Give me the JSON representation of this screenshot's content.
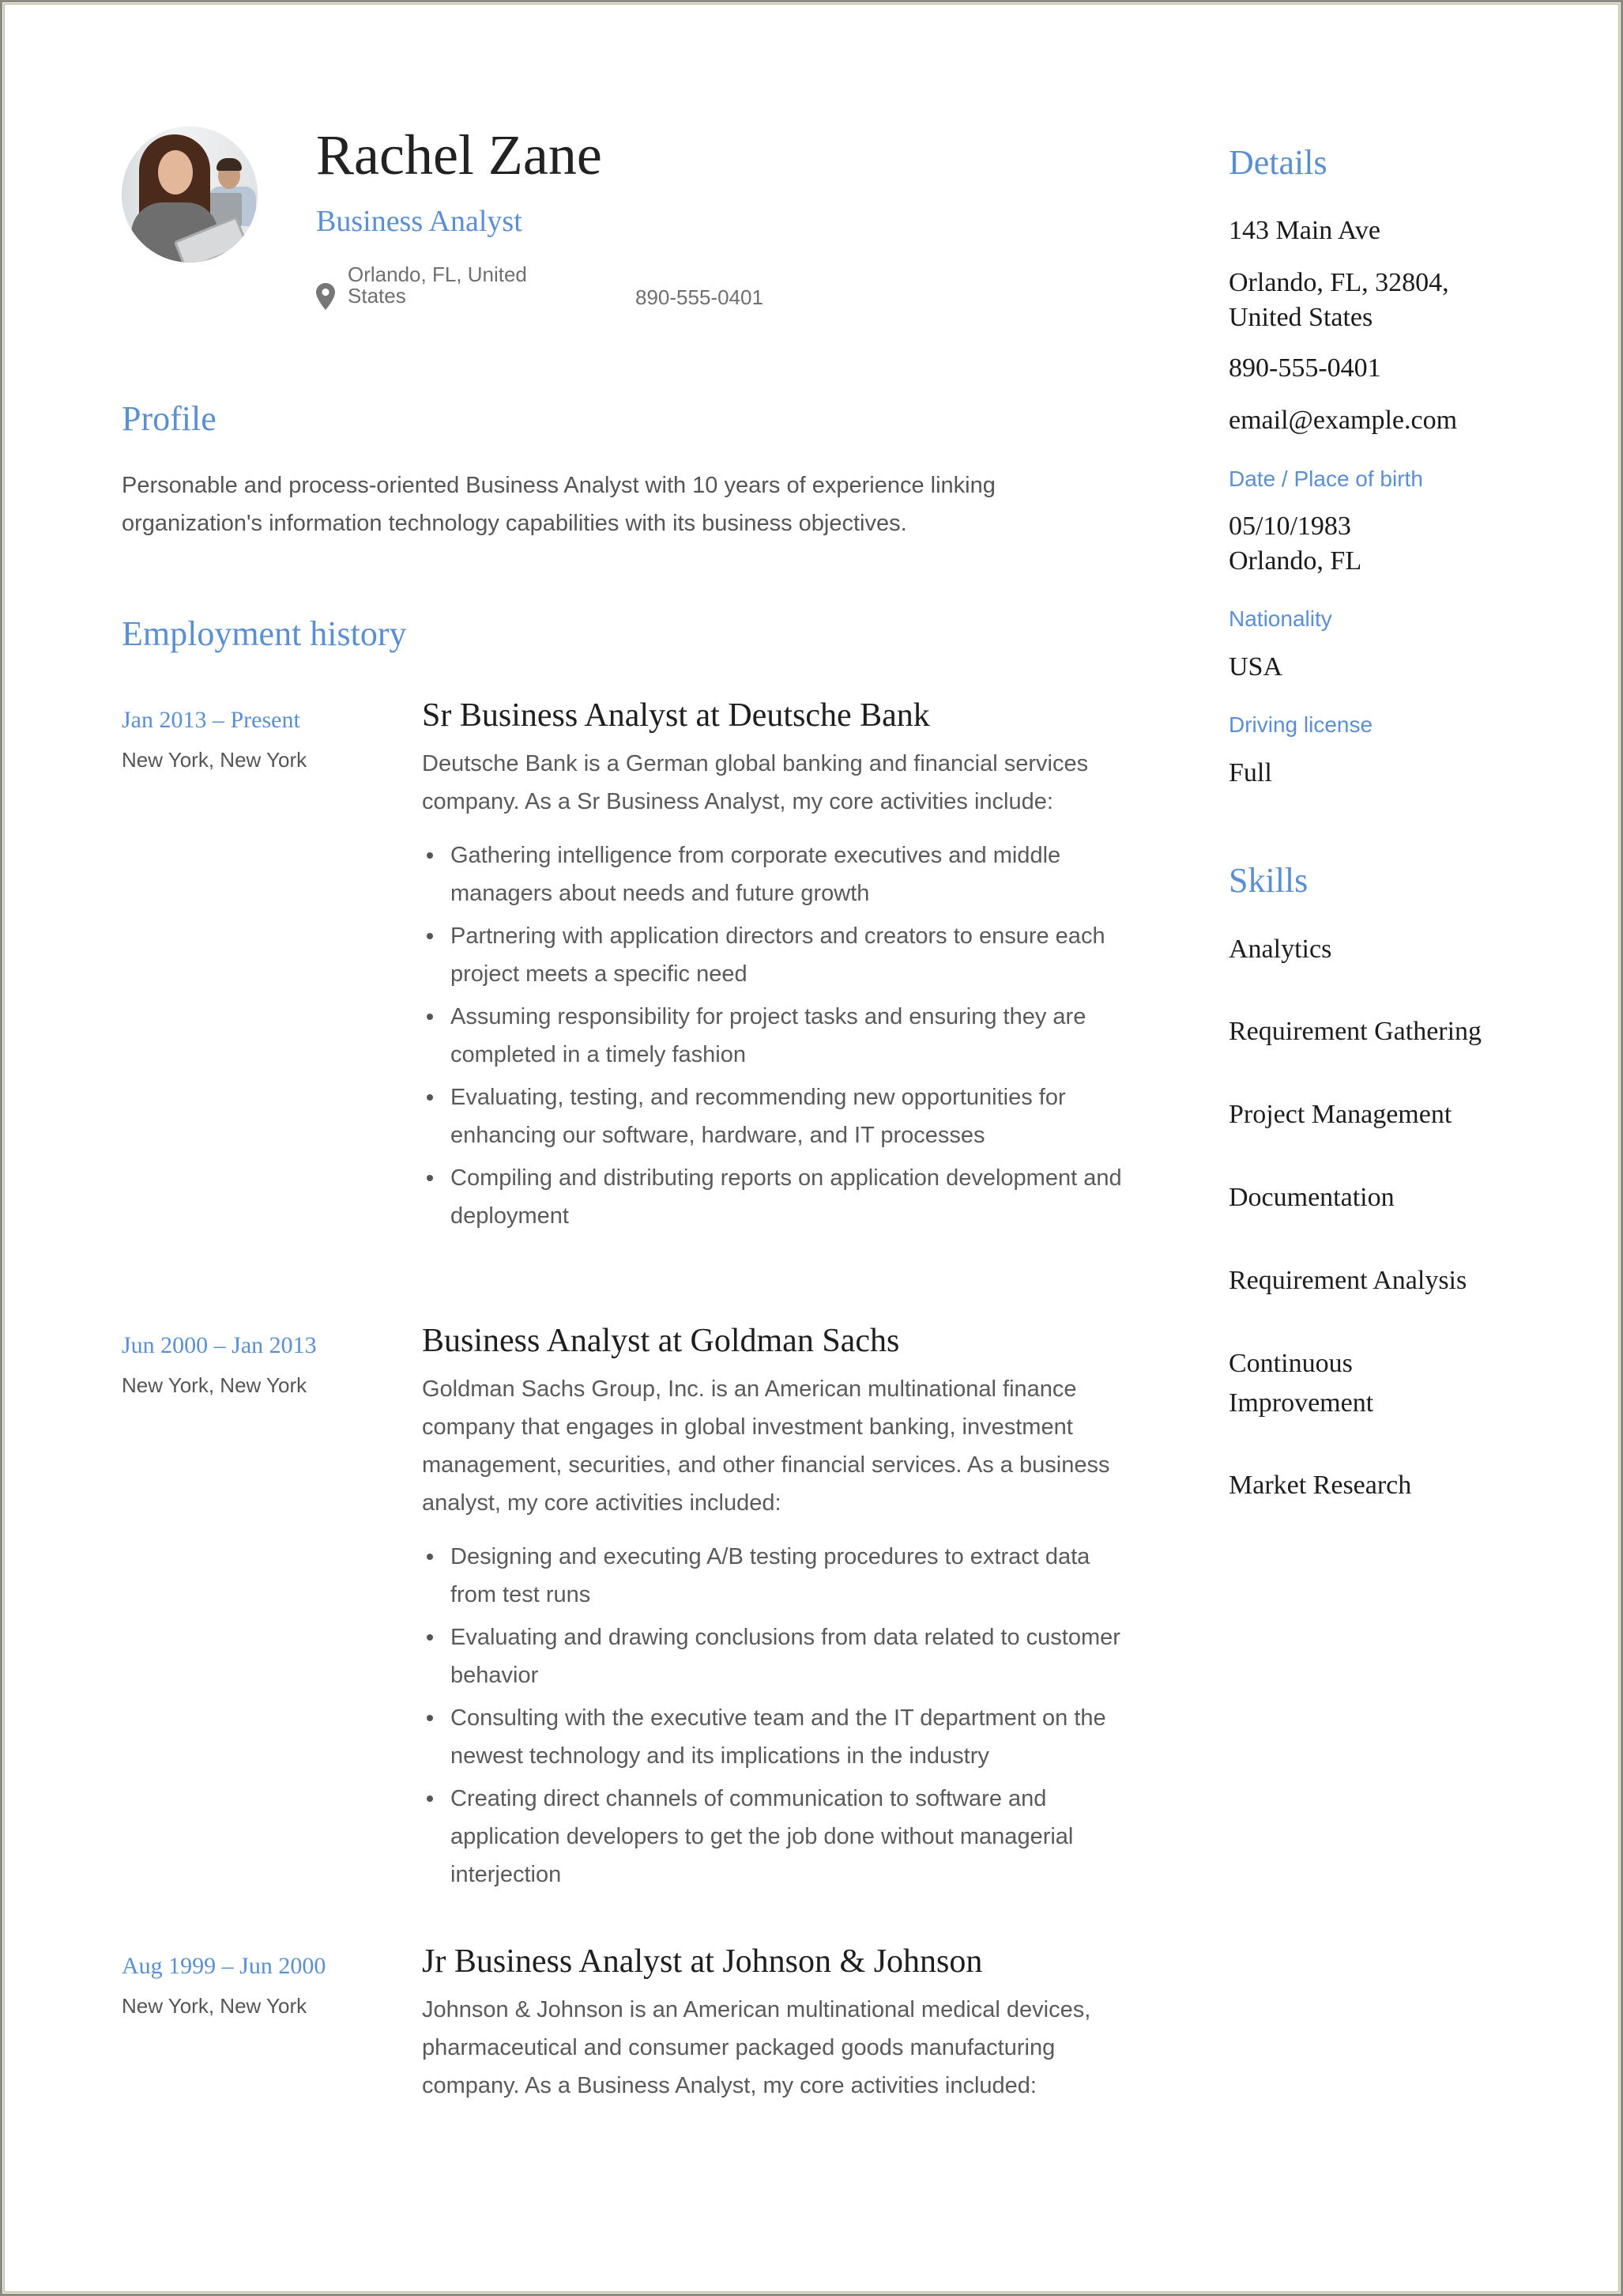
{
  "header": {
    "name": "Rachel Zane",
    "title": "Business Analyst",
    "location": "Orlando, FL, United States",
    "phone": "890-555-0401",
    "avatar_icon": "profile-photo"
  },
  "profile": {
    "heading": "Profile",
    "text": "Personable and process-oriented Business Analyst with 10 years of experience linking organization's information technology capabilities with its business objectives."
  },
  "employment": {
    "heading": "Employment history",
    "jobs": [
      {
        "dates": "Jan 2013 – Present",
        "place": "New York, New York",
        "role": "Sr Business Analyst at Deutsche Bank",
        "description": "Deutsche Bank is a German global banking and financial services company. As a Sr Business Analyst, my core activities include:",
        "bullets": [
          "Gathering intelligence from corporate executives and middle managers about needs and future growth",
          "Partnering with application directors and creators to ensure each project meets a specific need",
          "Assuming responsibility for project tasks and ensuring they are completed in a timely fashion",
          "Evaluating, testing, and recommending new opportunities for enhancing our software, hardware, and IT processes",
          "Compiling and distributing reports on application development and deployment"
        ]
      },
      {
        "dates": "Jun 2000 – Jan 2013",
        "place": "New York, New York",
        "role": "Business Analyst at Goldman Sachs",
        "description": "Goldman Sachs Group, Inc. is an American multinational finance company that engages in global investment banking, investment management, securities, and other financial services. As a business analyst, my core activities included:",
        "bullets": [
          "Designing and executing A/B testing procedures to extract data from test runs",
          "Evaluating and drawing conclusions from data related to customer behavior",
          "Consulting with the executive team and the IT department on the newest technology and its implications in the industry",
          "Creating direct channels of communication to software and application developers to get the job done without managerial interjection"
        ]
      },
      {
        "dates": "Aug 1999 – Jun 2000",
        "place": "New York, New York",
        "role": "Jr Business Analyst at Johnson & Johnson",
        "description": "Johnson & Johnson is an American multinational medical devices, pharmaceutical and consumer packaged goods manufacturing company. As a Business Analyst, my core activities included:",
        "bullets": []
      }
    ]
  },
  "details": {
    "heading": "Details",
    "address_line1": "143 Main Ave",
    "address_line2": "Orlando, FL, 32804, United States",
    "phone": "890-555-0401",
    "email": "email@example.com",
    "birth_label": "Date / Place of birth",
    "birth_date": "05/10/1983",
    "birth_place": "Orlando, FL",
    "nationality_label": "Nationality",
    "nationality": "USA",
    "license_label": "Driving license",
    "license": "Full"
  },
  "skills": {
    "heading": "Skills",
    "items": [
      "Analytics",
      "Requirement Gathering",
      "Project Management",
      "Documentation",
      "Requirement Analysis",
      "Continuous Improvement",
      "Market Research"
    ]
  },
  "colors": {
    "accent": "#5b8fd4",
    "body_text": "#5a5a5a",
    "heading_text": "#1e1e1e"
  }
}
